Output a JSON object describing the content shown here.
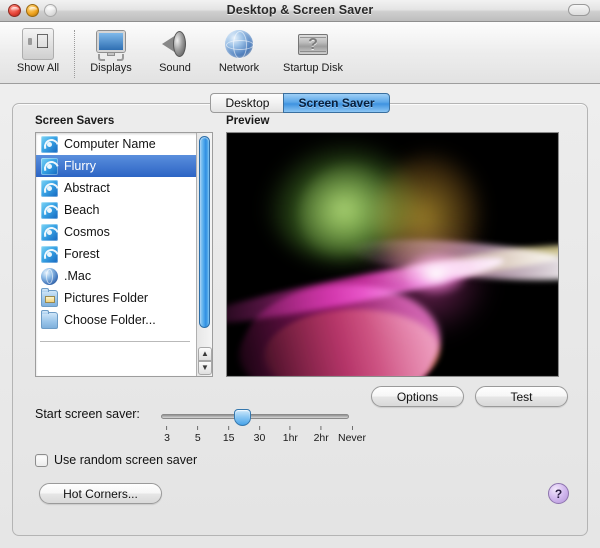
{
  "window": {
    "title": "Desktop & Screen Saver",
    "traffic": {
      "close": "close-button",
      "minimize": "minimize-button",
      "zoom": "zoom-button"
    },
    "toolbar_toggle": "toolbar-toggle"
  },
  "toolbar": {
    "items": [
      {
        "label": "Show All",
        "icon": "show-all-icon"
      },
      {
        "label": "Displays",
        "icon": "displays-icon"
      },
      {
        "label": "Sound",
        "icon": "sound-icon"
      },
      {
        "label": "Network",
        "icon": "network-globe-icon"
      },
      {
        "label": "Startup Disk",
        "icon": "startup-disk-icon"
      }
    ]
  },
  "tabs": [
    {
      "label": "Desktop",
      "selected": false
    },
    {
      "label": "Screen Saver",
      "selected": true
    }
  ],
  "screen_savers": {
    "group_label": "Screen Savers",
    "items": [
      {
        "name": "Computer Name",
        "icon": "screensaver-icon",
        "selected": false
      },
      {
        "name": "Flurry",
        "icon": "screensaver-icon",
        "selected": true
      },
      {
        "name": "Abstract",
        "icon": "screensaver-icon",
        "selected": false
      },
      {
        "name": "Beach",
        "icon": "screensaver-icon",
        "selected": false
      },
      {
        "name": "Cosmos",
        "icon": "screensaver-icon",
        "selected": false
      },
      {
        "name": "Forest",
        "icon": "screensaver-icon",
        "selected": false
      },
      {
        "name": ".Mac",
        "icon": "dotmac-globe-icon",
        "selected": false
      },
      {
        "name": "Pictures Folder",
        "icon": "pictures-folder-icon",
        "selected": false
      },
      {
        "name": "Choose Folder...",
        "icon": "folder-icon",
        "selected": false
      }
    ]
  },
  "preview": {
    "group_label": "Preview",
    "screensaver": "Flurry",
    "background_color": "#000000",
    "colors": [
      "#ff3fbe",
      "#ffffff",
      "#8fd14f",
      "#e0b53a",
      "#c8468d"
    ]
  },
  "buttons": {
    "options": "Options",
    "test": "Test",
    "hot_corners": "Hot Corners...",
    "help": "?"
  },
  "slider": {
    "label": "Start screen saver:",
    "value": "15",
    "ticks": [
      "3",
      "5",
      "15",
      "30",
      "1hr",
      "2hr",
      "Never"
    ]
  },
  "checkbox": {
    "label": "Use random screen saver",
    "checked": false
  },
  "accent_color": "#3f93e0"
}
